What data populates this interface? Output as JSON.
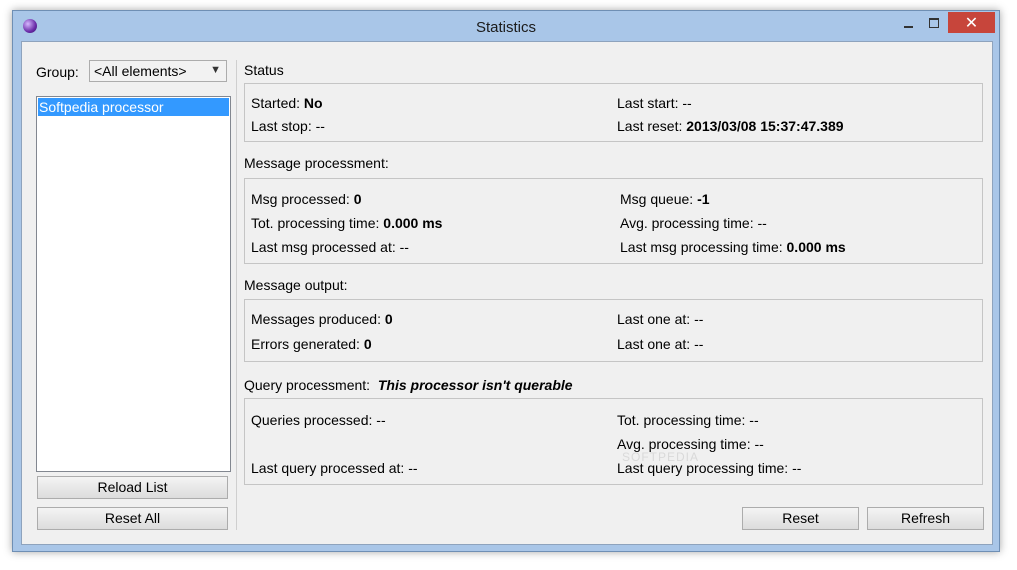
{
  "window": {
    "title": "Statistics",
    "close_glyph": "✕"
  },
  "left_panel": {
    "group_label": "Group:",
    "group_value": "<All elements>",
    "list_items": [
      "Softpedia processor"
    ],
    "reload_label": "Reload List",
    "reset_all_label": "Reset All"
  },
  "status": {
    "heading": "Status",
    "started_label": "Started: ",
    "started_value": "No",
    "last_start_label": "Last start: ",
    "last_start_value": "--",
    "last_stop_label": "Last stop: ",
    "last_stop_value": "--",
    "last_reset_label": "Last reset: ",
    "last_reset_value": "2013/03/08 15:37:47.389"
  },
  "message_processment": {
    "heading": "Message processment:",
    "msg_processed_label": "Msg processed: ",
    "msg_processed_value": "0",
    "msg_queue_label": "Msg queue: ",
    "msg_queue_value": "-1",
    "tot_time_label": "Tot. processing time: ",
    "tot_time_value": "0.000 ms",
    "avg_time_label": "Avg. processing time: ",
    "avg_time_value": "--",
    "last_msg_at_label": "Last msg processed at: ",
    "last_msg_at_value": "--",
    "last_msg_time_label": "Last msg processing time: ",
    "last_msg_time_value": "0.000 ms"
  },
  "message_output": {
    "heading": "Message output:",
    "produced_label": "Messages produced: ",
    "produced_value": "0",
    "last_one_label_1": "Last one at: ",
    "last_one_value_1": "--",
    "errors_label": "Errors generated: ",
    "errors_value": "0",
    "last_one_label_2": "Last one at: ",
    "last_one_value_2": "--"
  },
  "query_processment": {
    "heading": "Query processment:",
    "note": "This processor isn't querable",
    "queries_label": "Queries processed: ",
    "queries_value": "--",
    "tot_time_label": "Tot. processing time: ",
    "tot_time_value": "--",
    "avg_time_label": "Avg. processing time: ",
    "avg_time_value": "--",
    "last_query_at_label": "Last query processed at: ",
    "last_query_at_value": "--",
    "last_query_time_label": "Last query processing time: ",
    "last_query_time_value": "--"
  },
  "footer": {
    "reset_label": "Reset",
    "refresh_label": "Refresh"
  },
  "watermark": "SOFTPEDIA"
}
